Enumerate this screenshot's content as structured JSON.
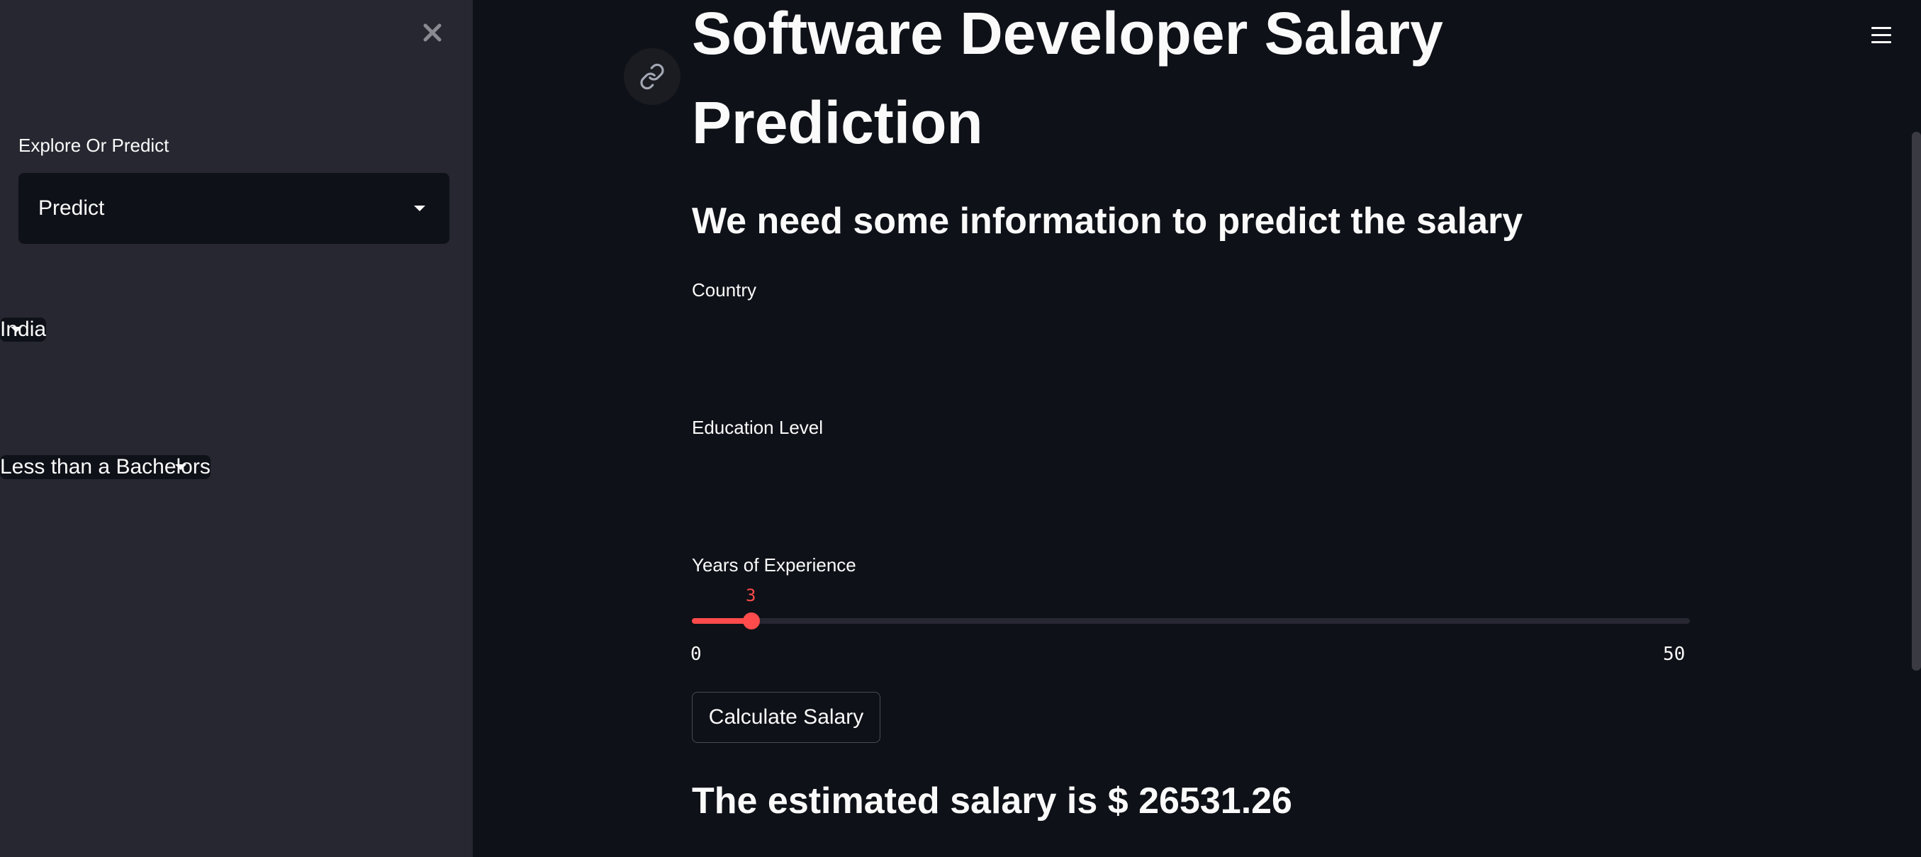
{
  "sidebar": {
    "label": "Explore Or Predict",
    "selected": "Predict"
  },
  "main": {
    "title": "Software Developer Salary Prediction",
    "subtitle": "We need some information to predict the salary",
    "country": {
      "label": "Country",
      "selected": "India"
    },
    "education": {
      "label": "Education Level",
      "selected": "Less than a Bachelors"
    },
    "experience": {
      "label": "Years of Experience",
      "value": "3",
      "min": "0",
      "max": "50",
      "fraction": 0.06
    },
    "button_label": "Calculate Salary",
    "result": "The estimated salary is $ 26531.26"
  },
  "colors": {
    "accent": "#ff4b4b",
    "sidebar_bg": "#262730",
    "main_bg": "#0e1117",
    "input_bg": "#262730"
  },
  "icons": [
    "close-icon",
    "link-icon",
    "hamburger-menu-icon",
    "caret-down-icon"
  ]
}
